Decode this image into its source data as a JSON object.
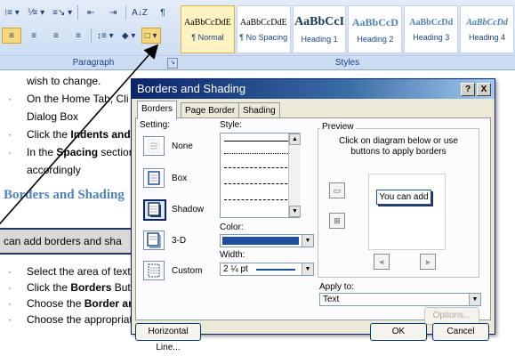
{
  "ribbon": {
    "row1_buttons": [
      "⁝≡ ▾",
      "⅟≡ ▾",
      "≡↘ ▾",
      "⇤",
      "⇥",
      "A↓Z",
      "¶"
    ],
    "row2_buttons": [
      "≡",
      "≡",
      "≡",
      "≡",
      "↕≡ ▾",
      "◆ ▾",
      "□ ▾"
    ],
    "group_paragraph": "Paragraph",
    "group_styles": "Styles",
    "launcher": "↘",
    "styles": [
      {
        "sample": "AaBbCcDdE",
        "name": "¶ Normal"
      },
      {
        "sample": "AaBbCcDdE",
        "name": "¶ No Spacing"
      },
      {
        "sample": "AaBbCcI",
        "name": "Heading 1"
      },
      {
        "sample": "AaBbCcD",
        "name": "Heading 2"
      },
      {
        "sample": "AaBbCcDd",
        "name": "Heading 3"
      },
      {
        "sample": "AaBbCcDd",
        "name": "Heading 4"
      }
    ]
  },
  "document": {
    "line1": "wish to change.",
    "line2": "On the Home Tab, Cli",
    "line3": "Dialog Box",
    "line4_pre": "Click the ",
    "line4_bold": "Indents and",
    "line5_pre": "In the ",
    "line5_bold": "Spacing",
    "line5_post": " section",
    "line6": "accordingly",
    "heading": "Borders and Shading",
    "band_text": "can add borders and sha",
    "line7": "Select the area of text",
    "line8_pre": "Click the ",
    "line8_bold": "Borders",
    "line8_post": " Butt",
    "line9_pre": "Choose the ",
    "line9_bold": "Border ar",
    "line10": "Choose the appropriat",
    "bullet": "·"
  },
  "dialog": {
    "title": "Borders and Shading",
    "help": "?",
    "close": "X",
    "tabs": [
      "Borders",
      "Page Border",
      "Shading"
    ],
    "setting_label": "Setting:",
    "settings": [
      "None",
      "Box",
      "Shadow",
      "3-D",
      "Custom"
    ],
    "style_label": "Style:",
    "color_label": "Color:",
    "color_value": "#1f4e9a",
    "width_label": "Width:",
    "width_value": "2 ¼ pt",
    "preview_label": "Preview",
    "preview_hint": "Click on diagram below or use buttons to apply borders",
    "preview_text": "You can add",
    "apply_label": "Apply to:",
    "apply_value": "Text",
    "options_button": "Options...",
    "horizontal_line_button": "Horizontal Line...",
    "ok_button": "OK",
    "cancel_button": "Cancel"
  }
}
